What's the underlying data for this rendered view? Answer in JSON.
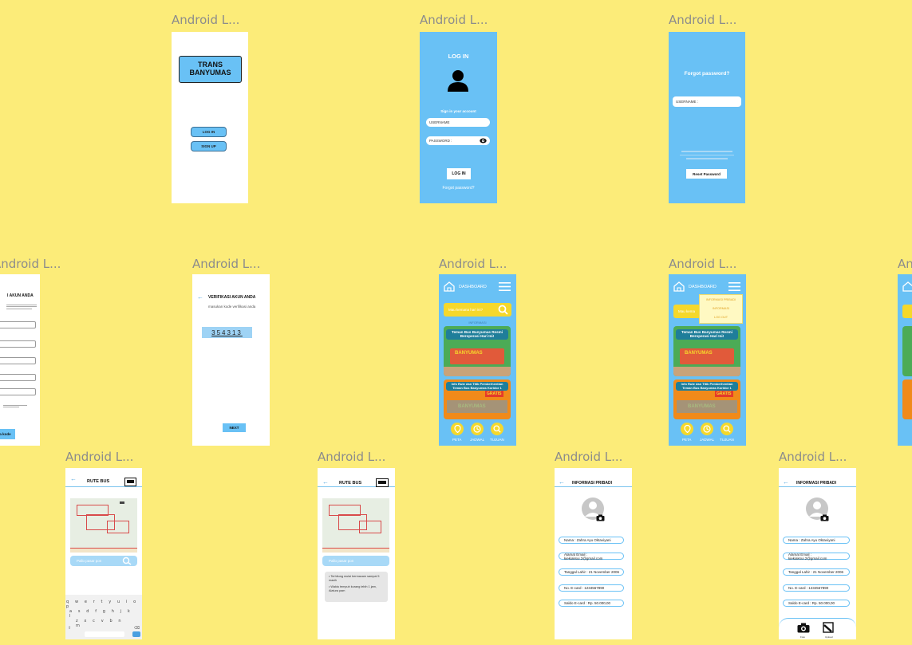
{
  "frame_label": "Android L...",
  "colors": {
    "canvas": "#fcec79",
    "brand_blue": "#69c1f5",
    "accent_yellow": "#f5d82b",
    "poster_green": "#3a9d4a",
    "poster_orange": "#f08a1a"
  },
  "splash": {
    "title": "TRANS BANYUMAS",
    "login_button": "LOG IN",
    "signup_button": "SIGN UP"
  },
  "login": {
    "title": "LOG IN",
    "subtitle": "Sign in your account",
    "username_placeholder": "USERNAME",
    "password_placeholder": "PASSWORD :",
    "login_button": "LOG IN",
    "forgot_link": "Forgot password?"
  },
  "forgot": {
    "title": "Forgot password?",
    "username_placeholder": "USERNAME :",
    "reset_button": "Reset Password"
  },
  "register": {
    "title": "I AKUN ANDA",
    "button": "a kode"
  },
  "verify": {
    "title": "VERIFIKASI AKUN ANDA",
    "instruction": "masukan kode verifikasi anda",
    "code": "354313",
    "next_button": "NEXT"
  },
  "dashboard": {
    "title": "DASHBOARD",
    "search_placeholder": "Mau kemana hari ini?",
    "section_label": "INFORMASI",
    "poster1_text": "Teman Bus Banyumas Resmi Beroperasi Hari Ini!",
    "poster2_text": "Info Rute dan Titik Pemberhentian Teman Bus Banyumas Koridor 1",
    "poster_brand": "BANYUMAS",
    "poster_tag": "GRATIS",
    "nav": [
      "PETA",
      "JADWAL",
      "TUJUAN"
    ]
  },
  "dashboard_menu": {
    "items": [
      "INFORMASI PRIBADI",
      "INFORMASI",
      "LOG OUT"
    ],
    "search_placeholder": "Mau kema"
  },
  "route_keyboard": {
    "title": "RUTE BUS",
    "search_placeholder": "Pallo pasar pon",
    "keyboard_rows": [
      "q w e r t y u i o p",
      "a s d f g h j k l",
      "z x c v b n m"
    ]
  },
  "route_info": {
    "title": "RUTE BUS",
    "search_placeholder": "Pallo pasar pon",
    "notes": [
      "Terhitung mulai bermacam sampai 5 masih",
      "Waktu tempuh kurang lebih 1 jam, Alatura pam"
    ]
  },
  "profile": {
    "title": "INFORMASI PRIBADI",
    "fields": [
      "Nama : Zahra Ayu Oktaviyani",
      "Alamat Email : kiekiaksui.2@gmail.com",
      "Tanggal Lahir : 21 November 2006",
      "No. E-card : 1234567890",
      "Saldo E-card : Rp. 50.000,00"
    ]
  },
  "profile_photo": {
    "title": "INFORMASI PRIBADI",
    "fields": [
      "Nama : Zahra Ayu Oktaviyani",
      "Alamat Email : kiekiaksui.2@gmail.com",
      "Tanggal Lahir : 21 November 2006",
      "No. E-card : 1234567890",
      "Saldo E-card : Rp. 50.000,00"
    ],
    "actions": [
      "Foto",
      "Upload"
    ]
  }
}
